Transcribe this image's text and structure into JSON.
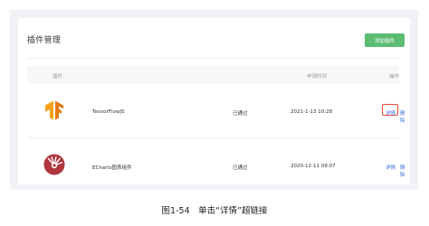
{
  "panel": {
    "title": "插件管理",
    "add_button": "添加插件"
  },
  "table": {
    "headers": {
      "plugin": "插件",
      "apply_time": "申请时间",
      "operation": "操作"
    },
    "rows": [
      {
        "icon": "tensorflow-logo",
        "name": "TensorFlowJS",
        "status": "已通过",
        "time": "2021-1-13 10:28",
        "detail": "详情",
        "delete": "删除"
      },
      {
        "icon": "echarts-logo",
        "name": "ECharts图表组件",
        "status": "已通过",
        "time": "2020-12-11 09:07",
        "detail": "详情",
        "delete": "删除"
      }
    ]
  },
  "caption": "图1-54　单击“详情”超链接",
  "colors": {
    "accent_green": "#5cbd72",
    "link_blue": "#3a6fd8",
    "highlight_red": "#e34a3a"
  }
}
